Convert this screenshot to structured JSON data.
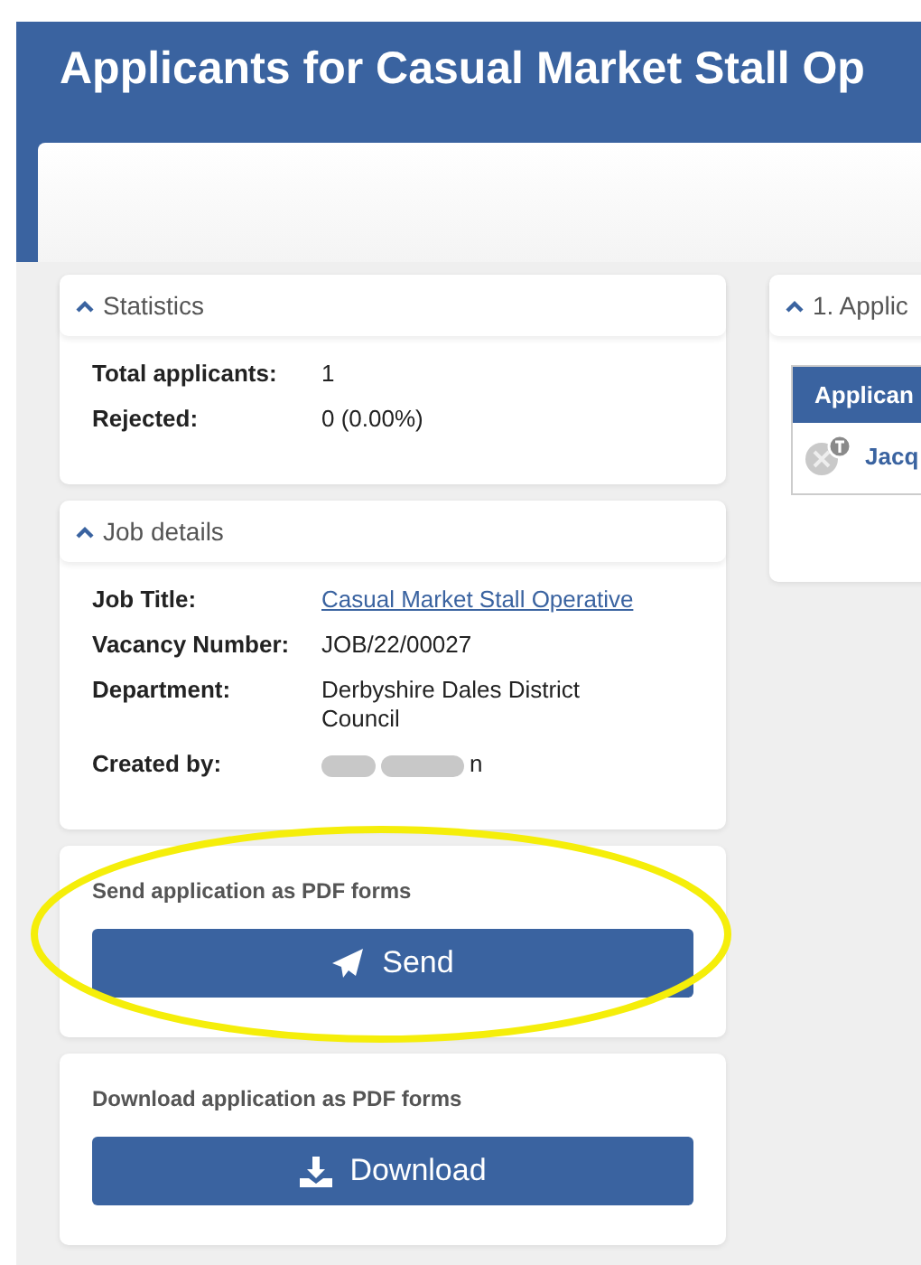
{
  "page_title": "Applicants for Casual Market Stall Op",
  "statistics": {
    "title": "Statistics",
    "expanded": true,
    "rows": [
      {
        "label": "Total applicants:",
        "value": "1"
      },
      {
        "label": "Rejected:",
        "value": "0 (0.00%)"
      }
    ]
  },
  "job_details": {
    "title": "Job details",
    "expanded": true,
    "rows": [
      {
        "label": "Job Title:",
        "value": "Casual Market Stall Operative",
        "kind": "link"
      },
      {
        "label": "Vacancy Number:",
        "value": "JOB/22/00027",
        "kind": "text"
      },
      {
        "label": "Department:",
        "value": "Derbyshire Dales District Council",
        "kind": "text"
      },
      {
        "label": "Created by:",
        "value": "n",
        "kind": "redacted"
      }
    ]
  },
  "actions": [
    {
      "caption": "Send application as PDF forms",
      "button": "Send",
      "kind": "send"
    },
    {
      "caption": "Download application as PDF forms",
      "button": "Download",
      "kind": "download"
    }
  ],
  "applicants_panel": {
    "title": "1. Applic",
    "expanded": true,
    "column": "Applican",
    "rows": [
      {
        "name": "Jacq"
      }
    ]
  }
}
